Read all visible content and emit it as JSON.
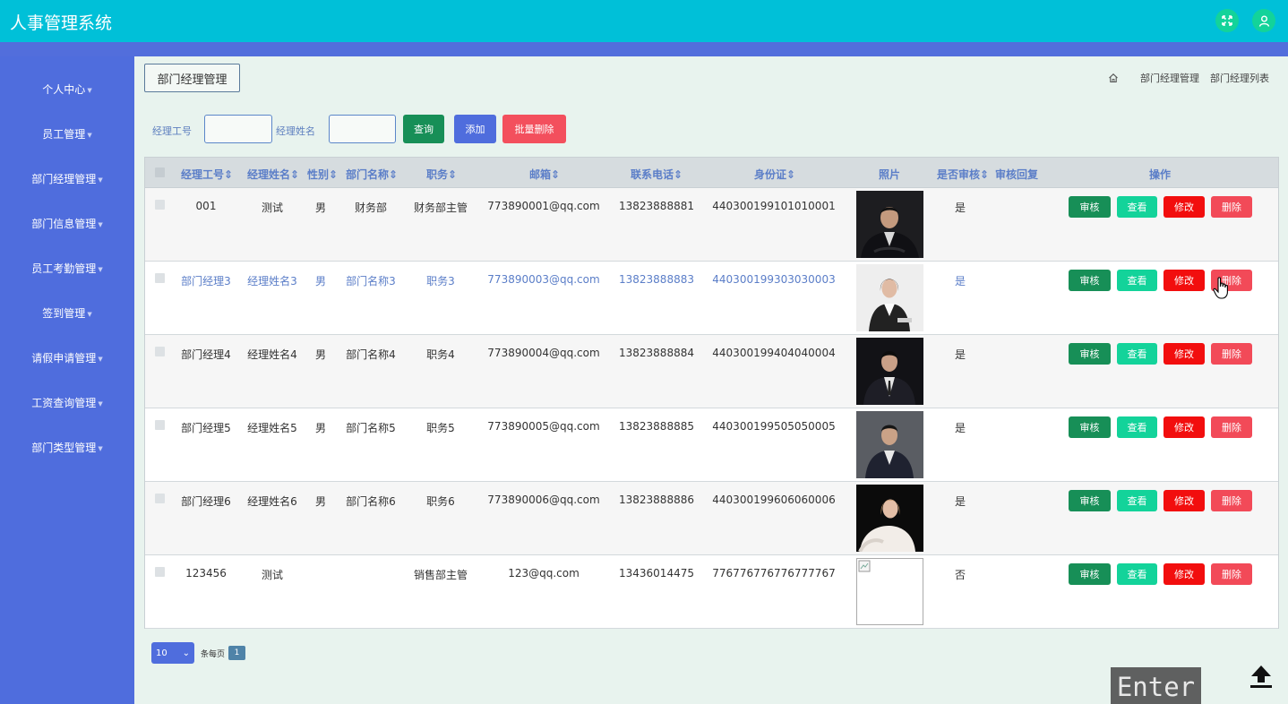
{
  "header": {
    "title": "人事管理系统",
    "fullscreen_icon": "fullscreen-icon",
    "user_icon": "user-icon"
  },
  "sidebar": {
    "items": [
      {
        "label": "个人中心"
      },
      {
        "label": "员工管理"
      },
      {
        "label": "部门经理管理"
      },
      {
        "label": "部门信息管理"
      },
      {
        "label": "员工考勤管理"
      },
      {
        "label": "签到管理"
      },
      {
        "label": "请假申请管理"
      },
      {
        "label": "工资查询管理"
      },
      {
        "label": "部门类型管理"
      }
    ]
  },
  "page": {
    "tag": "部门经理管理",
    "breadcrumb": [
      "部门经理管理",
      "部门经理列表"
    ]
  },
  "search": {
    "id_label": "经理工号",
    "id_value": "",
    "name_label": "经理姓名",
    "name_value": "",
    "query": "查询",
    "add": "添加",
    "batch_delete": "批量删除"
  },
  "table": {
    "columns": [
      "经理工号",
      "经理姓名",
      "性别",
      "部门名称",
      "职务",
      "邮箱",
      "联系电话",
      "身份证",
      "照片",
      "是否审核",
      "审核回复",
      "操作"
    ],
    "sortable_marker": "⇕",
    "actions": {
      "audit": "审核",
      "view": "查看",
      "edit": "修改",
      "delete": "删除"
    },
    "rows": [
      {
        "id": "001",
        "name": "测试",
        "gender": "男",
        "dept": "财务部",
        "title": "财务部主管",
        "email": "773890001@qq.com",
        "phone": "13823888881",
        "idcard": "440300199101010001",
        "audited": "是",
        "reply": ""
      },
      {
        "id": "部门经理3",
        "name": "经理姓名3",
        "gender": "男",
        "dept": "部门名称3",
        "title": "职务3",
        "email": "773890003@qq.com",
        "phone": "13823888883",
        "idcard": "440300199303030003",
        "audited": "是",
        "reply": ""
      },
      {
        "id": "部门经理4",
        "name": "经理姓名4",
        "gender": "男",
        "dept": "部门名称4",
        "title": "职务4",
        "email": "773890004@qq.com",
        "phone": "13823888884",
        "idcard": "440300199404040004",
        "audited": "是",
        "reply": ""
      },
      {
        "id": "部门经理5",
        "name": "经理姓名5",
        "gender": "男",
        "dept": "部门名称5",
        "title": "职务5",
        "email": "773890005@qq.com",
        "phone": "13823888885",
        "idcard": "440300199505050005",
        "audited": "是",
        "reply": ""
      },
      {
        "id": "部门经理6",
        "name": "经理姓名6",
        "gender": "男",
        "dept": "部门名称6",
        "title": "职务6",
        "email": "773890006@qq.com",
        "phone": "13823888886",
        "idcard": "440300199606060006",
        "audited": "是",
        "reply": ""
      },
      {
        "id": "123456",
        "name": "测试",
        "gender": "",
        "dept": "",
        "title": "销售部主管",
        "email": "123@qq.com",
        "phone": "13436014475",
        "idcard": "776776776776777767",
        "audited": "否",
        "reply": ""
      }
    ]
  },
  "pager": {
    "page_size": "10",
    "per_page_label": "条每页",
    "current_page": "1"
  },
  "overlay": {
    "key_hint": "Enter"
  },
  "colors": {
    "header": "#00c0d8",
    "sidebar": "#4f6ddd",
    "audit": "#178f57",
    "view": "#13d39a",
    "edit": "#f20e0e",
    "delete": "#f24a58"
  }
}
